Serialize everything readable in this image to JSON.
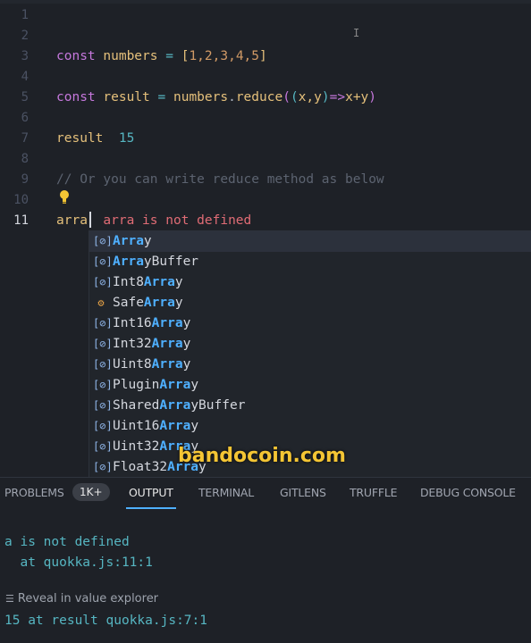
{
  "editor": {
    "line_numbers": [
      "1",
      "2",
      "3",
      "4",
      "5",
      "6",
      "7",
      "8",
      "9",
      "10",
      "11"
    ],
    "line3": {
      "kw": "const",
      "name": "numbers",
      "eq": " = ",
      "open": "[",
      "nums": "1,2,3,4,5",
      "close": "]"
    },
    "line5": {
      "kw": "const",
      "name": "result",
      "eq": " = ",
      "obj": "numbers",
      "dot": ".",
      "fn": "reduce",
      "p1": "(",
      "p2": "(",
      "args": "x,y",
      "p3": ")",
      "arrow": "=>",
      "expr": "x+y",
      "p4": ")"
    },
    "line7": {
      "name": "result",
      "value": "15"
    },
    "line9": {
      "comment": "// Or you can write reduce method as below"
    },
    "line11": {
      "typed": "arra",
      "error": "arra is not defined"
    }
  },
  "suggestions": [
    {
      "pre": "",
      "hl": "Arra",
      "post": "y",
      "icon": "variable-icon"
    },
    {
      "pre": "",
      "hl": "Arra",
      "post": "yBuffer",
      "icon": "variable-icon"
    },
    {
      "pre": "Int8",
      "hl": "Arra",
      "post": "y",
      "icon": "variable-icon"
    },
    {
      "pre": "Safe",
      "hl": "Arra",
      "post": "y",
      "icon": "class-icon"
    },
    {
      "pre": "Int16",
      "hl": "Arra",
      "post": "y",
      "icon": "variable-icon"
    },
    {
      "pre": "Int32",
      "hl": "Arra",
      "post": "y",
      "icon": "variable-icon"
    },
    {
      "pre": "Uint8",
      "hl": "Arra",
      "post": "y",
      "icon": "variable-icon"
    },
    {
      "pre": "Plugin",
      "hl": "Arra",
      "post": "y",
      "icon": "variable-icon"
    },
    {
      "pre": "Shared",
      "hl": "Arra",
      "post": "yBuffer",
      "icon": "variable-icon"
    },
    {
      "pre": "Uint16",
      "hl": "Arra",
      "post": "y",
      "icon": "variable-icon"
    },
    {
      "pre": "Uint32",
      "hl": "Arra",
      "post": "y",
      "icon": "variable-icon"
    },
    {
      "pre": "Float32",
      "hl": "Arra",
      "post": "y",
      "icon": "variable-icon"
    }
  ],
  "watermark": "bandocoin.com",
  "panel": {
    "tabs": {
      "problems": "PROBLEMS",
      "problems_badge": "1K+",
      "output": "OUTPUT",
      "terminal": "TERMINAL",
      "gitlens": "GITLENS",
      "truffle": "TRUFFLE",
      "debug": "DEBUG CONSOLE"
    },
    "out1": "a is not defined",
    "out2": "  at quokka.js:11:1",
    "reveal": "Reveal in value explorer",
    "out3_pre": "15 at result ",
    "out3_link": "quokka.js:7:1"
  },
  "colors": {
    "accent": "#4fb0ff",
    "error": "#e06c75",
    "keyword": "#c678dd",
    "watermark": "#f4c534"
  }
}
